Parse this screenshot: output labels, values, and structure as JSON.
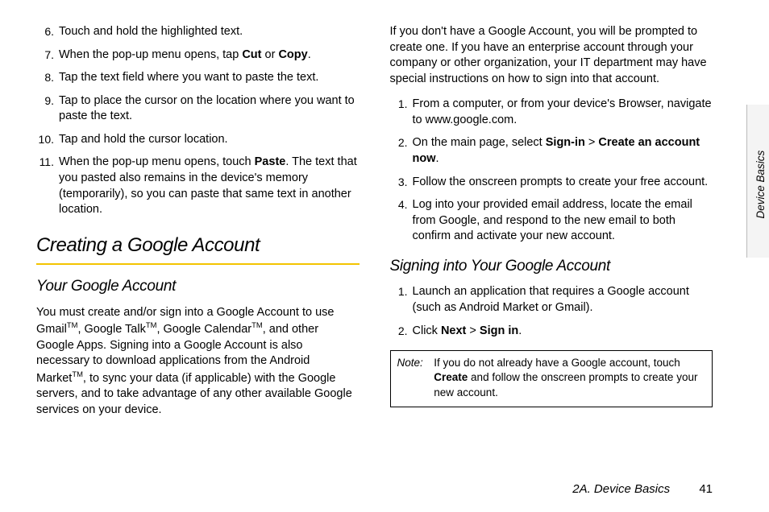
{
  "steps_a": [
    {
      "n": "6.",
      "html": "Touch and hold the highlighted text."
    },
    {
      "n": "7.",
      "html": "When the pop-up menu opens, tap <b>Cut</b> or <b>Copy</b>."
    },
    {
      "n": "8.",
      "html": "Tap the text field where you want to paste the text."
    },
    {
      "n": "9.",
      "html": "Tap to place the cursor on the location where you want to paste the text."
    },
    {
      "n": "10.",
      "html": "Tap and hold the cursor location."
    },
    {
      "n": "11.",
      "html": "When the pop-up menu opens, touch <b>Paste</b>. The text that you pasted also remains in the device's memory (temporarily), so you can paste that same text in another location."
    }
  ],
  "h1": "Creating a Google Account",
  "h2a": "Your Google Account",
  "para_a": "You must create and/or sign into a Google Account to use Gmail<sup class='tm'>TM</sup>, Google Talk<sup class='tm'>TM</sup>, Google Calendar<sup class='tm'>TM</sup>, and other Google Apps. Signing into a Google Account is also necessary to download applications from the Android Market<sup class='tm'>TM</sup>, to sync your data (if applicable) with the Google servers, and to take advantage of any other available Google services on your device.",
  "para_b": "If you don't have a Google Account, you will be prompted to create one. If you have an enterprise account through your company or other organization, your IT department may have special instructions on how to sign into that account.",
  "steps_b": [
    {
      "n": "1.",
      "html": "From a computer, or from your device's Browser, navigate to www.google.com."
    },
    {
      "n": "2.",
      "html": "On the main page, select <b>Sign-in</b> > <b>Create an account now</b>."
    },
    {
      "n": "3.",
      "html": "Follow the onscreen prompts to create your free account."
    },
    {
      "n": "4.",
      "html": "Log into your provided email address, locate the email from Google, and respond to the new email to both confirm and activate your new account."
    }
  ],
  "h2b": "Signing into Your Google Account",
  "steps_c": [
    {
      "n": "1.",
      "html": "Launch an application that requires a Google account (such as Android Market or Gmail)."
    },
    {
      "n": "2.",
      "html": "Click <b>Next</b> > <b>Sign in</b>."
    }
  ],
  "note_label": "Note:",
  "note_text": "If you do not already have a Google account, touch <b>Create</b> and follow the onscreen prompts to create your new account.",
  "footer_section": "2A. Device Basics",
  "footer_page": "41",
  "side_tab": "Device Basics"
}
